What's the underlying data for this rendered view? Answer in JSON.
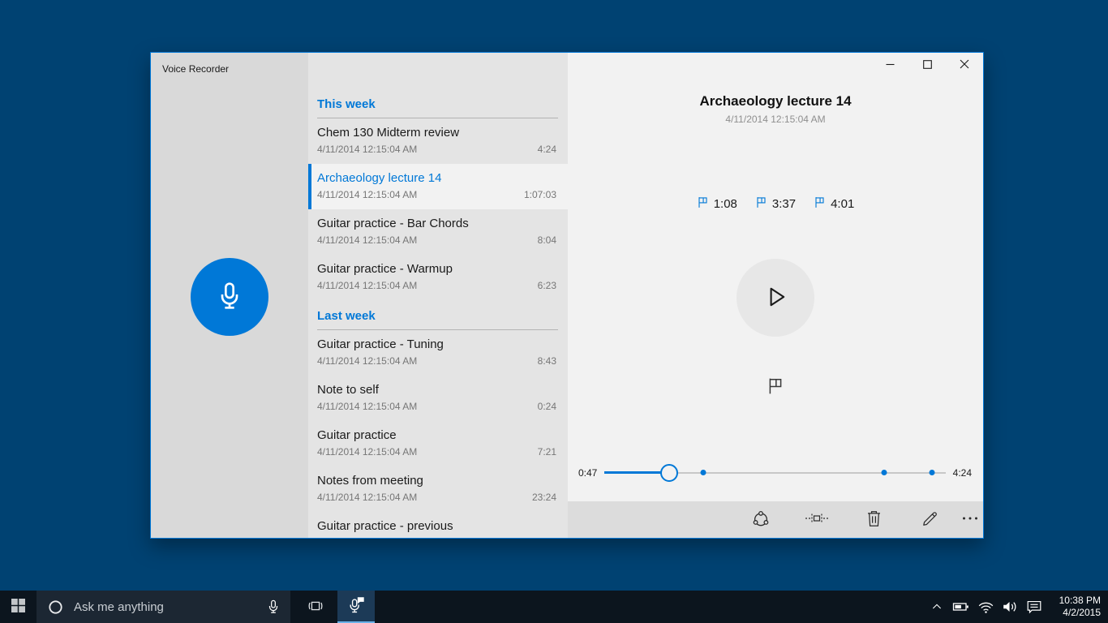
{
  "app": {
    "title": "Voice Recorder"
  },
  "recordings": {
    "sections": [
      {
        "header": "This week",
        "items": [
          {
            "title": "Chem 130 Midterm review",
            "date": "4/11/2014 12:15:04 AM",
            "duration": "4:24",
            "selected": false
          },
          {
            "title": "Archaeology lecture 14",
            "date": "4/11/2014 12:15:04 AM",
            "duration": "1:07:03",
            "selected": true
          },
          {
            "title": "Guitar practice - Bar Chords",
            "date": "4/11/2014 12:15:04 AM",
            "duration": "8:04",
            "selected": false
          },
          {
            "title": "Guitar practice - Warmup",
            "date": "4/11/2014 12:15:04 AM",
            "duration": "6:23",
            "selected": false
          }
        ]
      },
      {
        "header": "Last week",
        "items": [
          {
            "title": "Guitar practice - Tuning",
            "date": "4/11/2014 12:15:04 AM",
            "duration": "8:43",
            "selected": false
          },
          {
            "title": "Note to self",
            "date": "4/11/2014 12:15:04 AM",
            "duration": "0:24",
            "selected": false
          },
          {
            "title": "Guitar practice",
            "date": "4/11/2014 12:15:04 AM",
            "duration": "7:21",
            "selected": false
          },
          {
            "title": "Notes from meeting",
            "date": "4/11/2014 12:15:04 AM",
            "duration": "23:24",
            "selected": false
          },
          {
            "title": "Guitar practice - previous",
            "date": "",
            "duration": "",
            "selected": false
          }
        ]
      }
    ]
  },
  "player": {
    "title": "Archaeology lecture 14",
    "date": "4/11/2014 12:15:04 AM",
    "flags": [
      {
        "time": "1:08"
      },
      {
        "time": "3:37"
      },
      {
        "time": "4:01"
      }
    ],
    "slider": {
      "current": "0:47",
      "total": "4:24",
      "progress_pct": 19,
      "marker_pcts": [
        29,
        82,
        96
      ]
    }
  },
  "taskbar": {
    "search_placeholder": "Ask me anything",
    "clock_time": "10:38 PM",
    "clock_date": "4/2/2015"
  },
  "icons": {
    "record": "microphone",
    "play": "play-triangle-outline",
    "flag": "flag",
    "share": "share-circle-nodes",
    "trim": "trim-dashed",
    "delete": "trash-can",
    "rename": "pencil",
    "more": "ellipsis",
    "minimize": "dash",
    "maximize": "square",
    "close": "x",
    "start": "windows-logo",
    "cortana": "ring",
    "search_mic": "microphone",
    "task_view": "bracketed-rect",
    "active_app": "microphone-chat-bubble",
    "tray": [
      "chevron-up",
      "battery",
      "wifi",
      "volume",
      "action-center"
    ]
  },
  "colors": {
    "accent": "#0078d7",
    "desktop": "#004272",
    "sidebar_bg": "#d9d9d9",
    "list_bg": "#e4e4e4",
    "detail_bg": "#f2f2f2",
    "toolbar_bg": "#dcdcdc",
    "taskbar_bg": "#0c151e",
    "search_bg": "#1c2733",
    "active_app_bg": "#1c3a57",
    "active_app_underline": "#6ab1e8"
  }
}
